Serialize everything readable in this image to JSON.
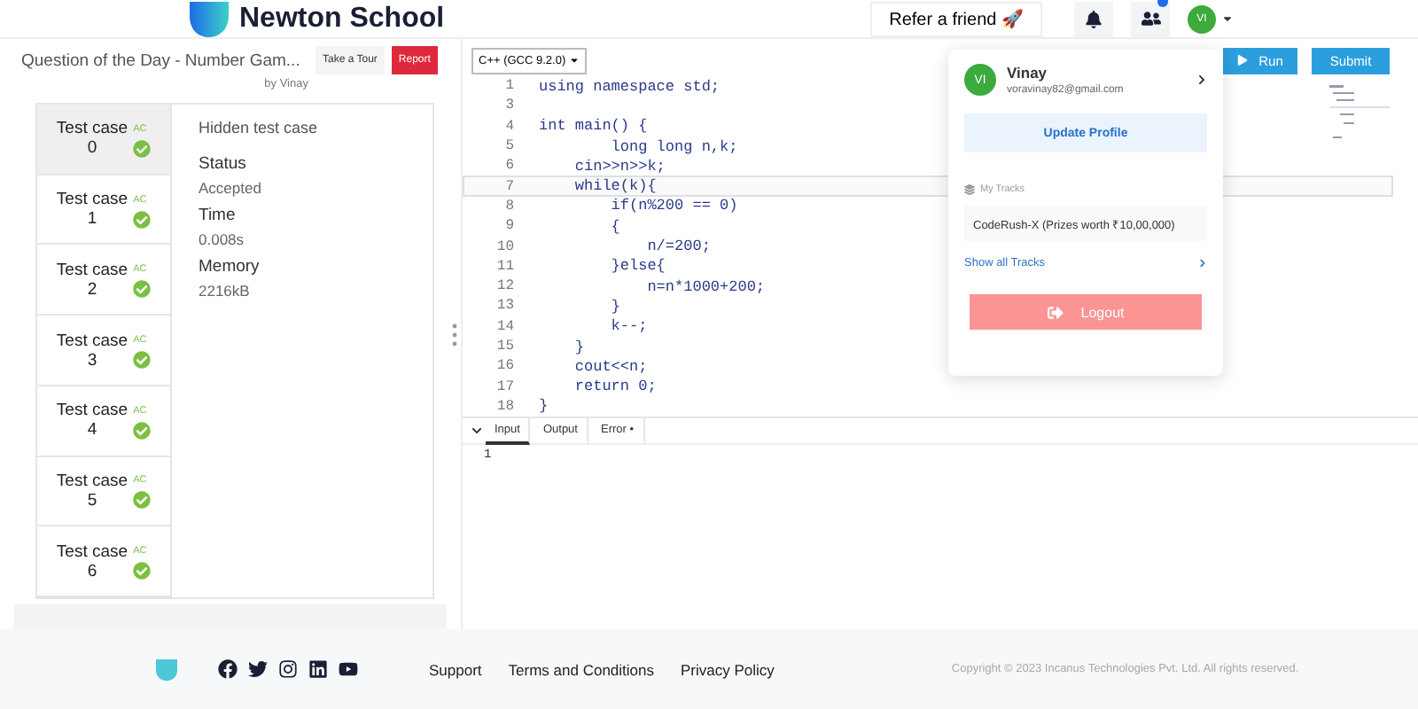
{
  "header": {
    "brand": "Newton School",
    "refer_button": "Refer a friend 🚀",
    "avatar_initials": "VI",
    "people_badge": true
  },
  "problem": {
    "title": "Question of the Day - Number Gam...",
    "author": "by Vinay",
    "buttons": [
      {
        "label": "Take a Tour",
        "kind": "plain"
      },
      {
        "label": "Report",
        "kind": "danger"
      }
    ]
  },
  "test_cases": [
    {
      "label": "Test case",
      "number": "0",
      "verdict": "AC",
      "selected": true
    },
    {
      "label": "Test case",
      "number": "1",
      "verdict": "AC",
      "selected": false
    },
    {
      "label": "Test case",
      "number": "2",
      "verdict": "AC",
      "selected": false
    },
    {
      "label": "Test case",
      "number": "3",
      "verdict": "AC",
      "selected": false
    },
    {
      "label": "Test case",
      "number": "4",
      "verdict": "AC",
      "selected": false
    },
    {
      "label": "Test case",
      "number": "5",
      "verdict": "AC",
      "selected": false
    },
    {
      "label": "Test case",
      "number": "6",
      "verdict": "AC",
      "selected": false
    }
  ],
  "result": {
    "heading": "Hidden test case",
    "fields": [
      {
        "label": "Status",
        "value": "Accepted"
      },
      {
        "label": "Time",
        "value": "0.008s"
      },
      {
        "label": "Memory",
        "value": "2216kB"
      }
    ]
  },
  "editor": {
    "language": "C++ (GCC 9.2.0)",
    "actions": [
      {
        "label": "Run",
        "kind": "run"
      },
      {
        "label": "Submit",
        "kind": "submit"
      }
    ],
    "lines": [
      {
        "number": "1",
        "code": "using namespace std;",
        "highlighted": false
      },
      {
        "number": "3",
        "highlighted": false
      },
      {
        "number": "4",
        "code": "int main() {",
        "highlighted": false
      },
      {
        "number": "5",
        "code": "        long long n,k;",
        "highlighted": false
      },
      {
        "number": "6",
        "code": "    cin>>n>>k;",
        "highlighted": false
      },
      {
        "number": "7",
        "code": "    while(k){",
        "highlighted": true
      },
      {
        "number": "8",
        "code": "        if(n%200 == 0)",
        "highlighted": false
      },
      {
        "number": "9",
        "code": "        {",
        "highlighted": false
      },
      {
        "number": "10",
        "code": "            n/=200;",
        "highlighted": false
      },
      {
        "number": "11",
        "code": "        }else{",
        "highlighted": false
      },
      {
        "number": "12",
        "code": "            n=n*1000+200;",
        "highlighted": false
      },
      {
        "number": "13",
        "code": "        }",
        "highlighted": false
      },
      {
        "number": "14",
        "code": "        k--;",
        "highlighted": false
      },
      {
        "number": "15",
        "code": "    }",
        "highlighted": false
      },
      {
        "number": "16",
        "code": "    cout<<n;",
        "highlighted": false
      },
      {
        "number": "17",
        "code": "    return 0;",
        "highlighted": false
      },
      {
        "number": "18",
        "code": "}",
        "highlighted": false
      }
    ],
    "panel_tabs": [
      {
        "label": "Input",
        "selected": true
      },
      {
        "label": "Output",
        "selected": false
      },
      {
        "label": "Error •",
        "selected": false
      }
    ],
    "input_lines": [
      "1"
    ]
  },
  "profile_menu": {
    "initials": "VI",
    "name": "Vinay",
    "email": "voravinay82@gmail.com",
    "update_button": "Update Profile",
    "tracks_heading": "My Tracks",
    "tracks": [
      "CodeRush-X (Prizes worth ₹10,00,000)"
    ],
    "show_all": "Show all Tracks",
    "logout": "Logout"
  },
  "footer": {
    "links": [
      "Support",
      "Terms and Conditions",
      "Privacy Policy"
    ],
    "copyright": "Copyright © 2023 Incanus Technologies Pvt. Ltd. All rights reserved."
  }
}
